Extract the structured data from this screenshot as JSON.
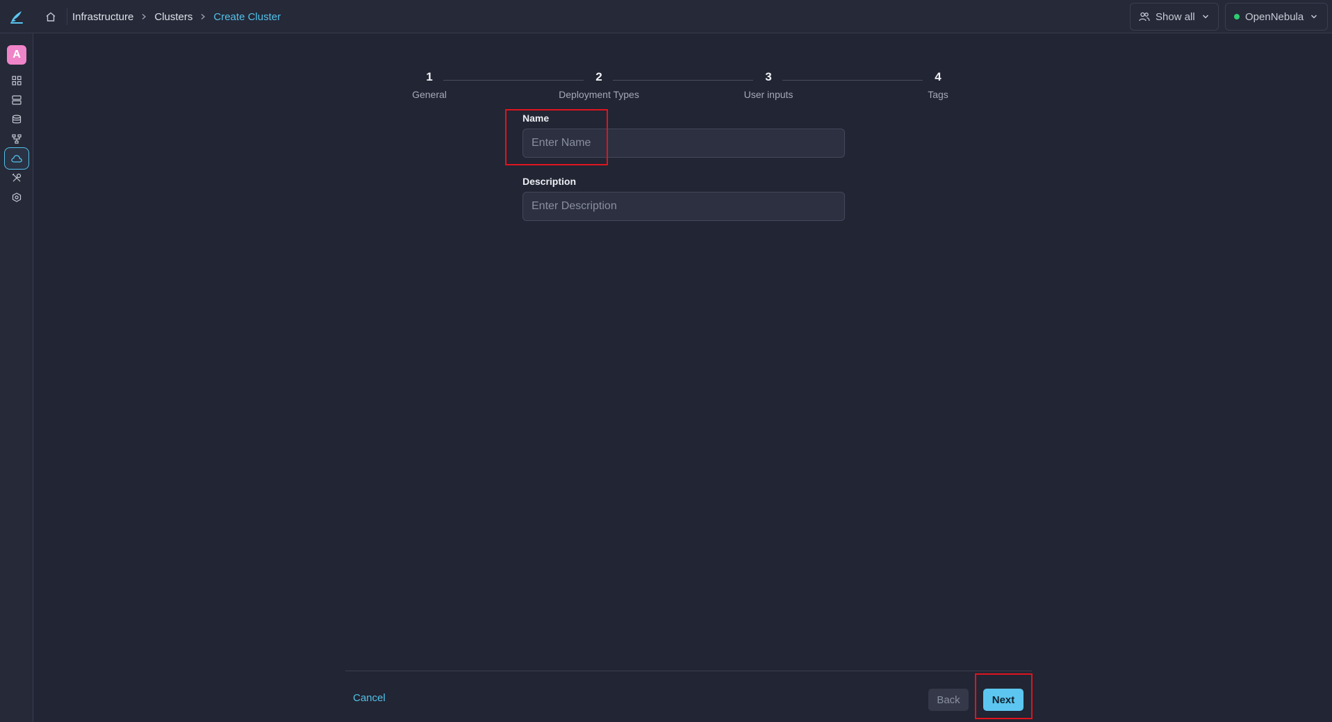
{
  "breadcrumb": {
    "items": [
      "Infrastructure",
      "Clusters"
    ],
    "current": "Create Cluster"
  },
  "topbar": {
    "group_filter_label": "Show all",
    "zone_label": "OpenNebula",
    "zone_status_color": "#2ecc71"
  },
  "sidebar": {
    "avatar_letter": "A",
    "items": [
      {
        "icon": "dashboard-grid-icon"
      },
      {
        "icon": "templates-icon"
      },
      {
        "icon": "storage-icon"
      },
      {
        "icon": "network-topology-icon"
      },
      {
        "icon": "cloud-icon",
        "active": true
      },
      {
        "icon": "tools-icon"
      },
      {
        "icon": "system-hexagon-icon"
      }
    ]
  },
  "stepper": {
    "steps": [
      {
        "number": "1",
        "label": "General"
      },
      {
        "number": "2",
        "label": "Deployment Types"
      },
      {
        "number": "3",
        "label": "User inputs"
      },
      {
        "number": "4",
        "label": "Tags"
      }
    ]
  },
  "form": {
    "name_label": "Name",
    "name_placeholder": "Enter Name",
    "name_value": "",
    "description_label": "Description",
    "description_placeholder": "Enter Description",
    "description_value": ""
  },
  "footer": {
    "cancel_label": "Cancel",
    "back_label": "Back",
    "next_label": "Next"
  },
  "colors": {
    "accent": "#53c2ea",
    "background": "#222533",
    "highlight": "#e0141e"
  }
}
